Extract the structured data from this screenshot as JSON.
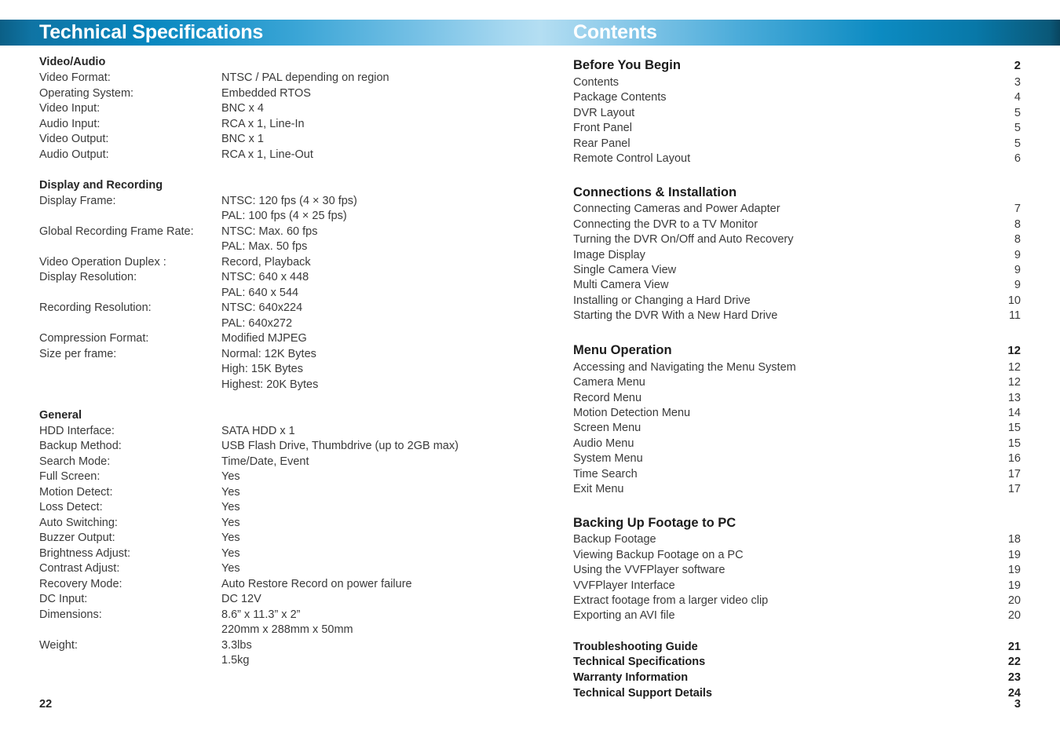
{
  "header": {
    "left_title": "Technical Specifications",
    "right_title": "Contents",
    "gradient_dark": "#0b5f86",
    "gradient_light": "#b4def2",
    "gradient_right": "#09455f"
  },
  "left_page": {
    "folio": "22",
    "groups": [
      {
        "title": "Video/Audio",
        "rows": [
          {
            "label": "Video Format:",
            "value": "NTSC / PAL depending on region"
          },
          {
            "label": "Operating System:",
            "value": "Embedded RTOS"
          },
          {
            "label": "Video Input:",
            "value": "BNC x 4"
          },
          {
            "label": "Audio Input:",
            "value": "RCA x 1, Line-In"
          },
          {
            "label": "Video Output:",
            "value": "BNC x 1"
          },
          {
            "label": "Audio Output:",
            "value": "RCA x 1, Line-Out"
          }
        ]
      },
      {
        "title": "Display and Recording",
        "rows": [
          {
            "label": "Display Frame:",
            "value": "NTSC: 120 fps (4 × 30 fps)"
          },
          {
            "label": "",
            "value": "PAL: 100 fps (4 × 25 fps)"
          },
          {
            "label": "Global Recording Frame Rate:",
            "value": "NTSC: Max. 60 fps"
          },
          {
            "label": "",
            "value": "PAL: Max. 50 fps"
          },
          {
            "label": "Video Operation Duplex :",
            "value": "Record, Playback"
          },
          {
            "label": "Display Resolution:",
            "value": "NTSC: 640 x 448"
          },
          {
            "label": "",
            "value": "PAL: 640 x 544"
          },
          {
            "label": "Recording Resolution:",
            "value": "NTSC: 640x224"
          },
          {
            "label": "",
            "value": "PAL: 640x272"
          },
          {
            "label": "Compression Format:",
            "value": "Modified MJPEG"
          },
          {
            "label": "Size per frame:",
            "value": "Normal: 12K Bytes"
          },
          {
            "label": "",
            "value": "High: 15K Bytes"
          },
          {
            "label": "",
            "value": "Highest: 20K Bytes"
          }
        ]
      },
      {
        "title": "General",
        "rows": [
          {
            "label": "HDD Interface:",
            "value": "SATA HDD x 1"
          },
          {
            "label": "Backup Method:",
            "value": "USB Flash Drive, Thumbdrive (up to 2GB max)"
          },
          {
            "label": "Search Mode:",
            "value": "Time/Date, Event"
          },
          {
            "label": "Full Screen:",
            "value": "Yes"
          },
          {
            "label": "Motion Detect:",
            "value": "Yes"
          },
          {
            "label": "Loss Detect:",
            "value": "Yes"
          },
          {
            "label": "Auto Switching:",
            "value": "Yes"
          },
          {
            "label": "Buzzer Output:",
            "value": "Yes"
          },
          {
            "label": "Brightness Adjust:",
            "value": "Yes"
          },
          {
            "label": "Contrast Adjust:",
            "value": "Yes"
          },
          {
            "label": "Recovery Mode:",
            "value": "Auto Restore Record on power failure"
          },
          {
            "label": "DC Input:",
            "value": "DC 12V"
          },
          {
            "label": "Dimensions:",
            "value": "8.6” x 11.3” x 2”"
          },
          {
            "label": "",
            "value": "220mm x 288mm x 50mm"
          },
          {
            "label": "Weight:",
            "value": "3.3lbs"
          },
          {
            "label": "",
            "value": "1.5kg"
          }
        ]
      }
    ]
  },
  "right_page": {
    "folio": "3",
    "sections": [
      {
        "heading": "Before You Begin",
        "heading_page": "2",
        "entries": [
          {
            "label": "Contents",
            "page": "3"
          },
          {
            "label": "Package Contents",
            "page": "4"
          },
          {
            "label": "DVR Layout",
            "page": "5"
          },
          {
            "label": "Front Panel",
            "page": "5"
          },
          {
            "label": "Rear Panel",
            "page": "5"
          },
          {
            "label": "Remote Control Layout",
            "page": "6"
          }
        ]
      },
      {
        "heading": "Connections & Installation",
        "heading_page": "",
        "entries": [
          {
            "label": "Connecting Cameras and Power Adapter",
            "page": "7"
          },
          {
            "label": "Connecting the DVR to a TV Monitor",
            "page": "8"
          },
          {
            "label": "Turning the DVR On/Off and Auto Recovery",
            "page": "8"
          },
          {
            "label": "Image Display",
            "page": "9"
          },
          {
            "label": "Single Camera View",
            "page": "9"
          },
          {
            "label": "Multi Camera View",
            "page": "9"
          },
          {
            "label": "Installing or Changing a Hard Drive",
            "page": "10"
          },
          {
            "label": "Starting the DVR With a New Hard Drive",
            "page": "11"
          }
        ]
      },
      {
        "heading": "Menu Operation",
        "heading_page": "12",
        "entries": [
          {
            "label": "Accessing and Navigating the Menu System",
            "page": "12"
          },
          {
            "label": "Camera Menu",
            "page": "12"
          },
          {
            "label": "Record Menu",
            "page": "13"
          },
          {
            "label": "Motion Detection Menu",
            "page": "14"
          },
          {
            "label": "Screen Menu",
            "page": "15"
          },
          {
            "label": "Audio Menu",
            "page": "15"
          },
          {
            "label": "System Menu",
            "page": "16"
          },
          {
            "label": "Time Search",
            "page": "17"
          },
          {
            "label": "Exit Menu",
            "page": "17"
          }
        ]
      },
      {
        "heading": "Backing Up Footage to PC",
        "heading_page": "",
        "entries": [
          {
            "label": "Backup Footage",
            "page": "18"
          },
          {
            "label": "Viewing Backup Footage on a PC",
            "page": "19"
          },
          {
            "label": "Using the VVFPlayer software",
            "page": "19"
          },
          {
            "label": "VVFPlayer Interface",
            "page": "19"
          },
          {
            "label": "Extract footage from a larger video clip",
            "page": "20"
          },
          {
            "label": "Exporting an AVI file",
            "page": "20"
          }
        ]
      }
    ],
    "bold_entries": [
      {
        "label": "Troubleshooting Guide",
        "page": "21"
      },
      {
        "label": "Technical Specifications",
        "page": "22"
      },
      {
        "label": "Warranty Information",
        "page": "23"
      },
      {
        "label": "Technical Support Details",
        "page": "24"
      }
    ]
  }
}
